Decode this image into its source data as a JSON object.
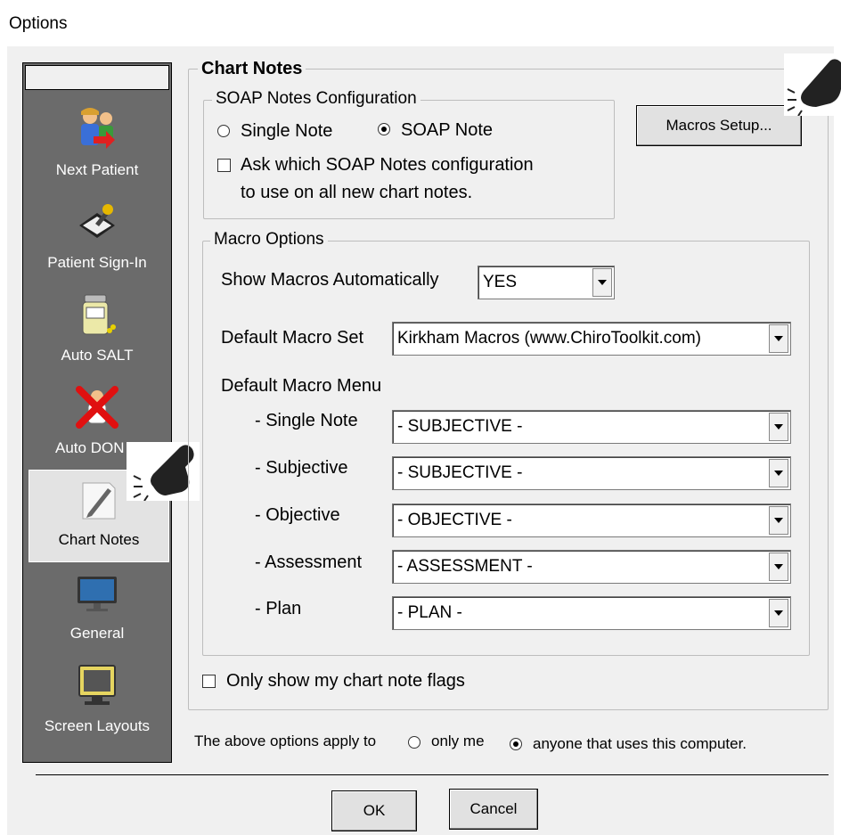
{
  "window": {
    "title": "Options"
  },
  "sidebar": {
    "items": [
      {
        "label": "Next Patient",
        "icon": "patients-icon"
      },
      {
        "label": "Patient Sign-In",
        "icon": "signin-pen-icon"
      },
      {
        "label": "Auto SALT",
        "icon": "salt-jar-icon"
      },
      {
        "label": "Auto DON",
        "icon": "red-x-person-icon"
      },
      {
        "label": "Chart Notes",
        "icon": "pencil-paper-icon"
      },
      {
        "label": "General",
        "icon": "monitor-icon"
      },
      {
        "label": "Screen Layouts",
        "icon": "screen-layout-icon"
      }
    ]
  },
  "chart_notes": {
    "legend": "Chart Notes",
    "soap": {
      "legend": "SOAP Notes Configuration",
      "single_note": "Single Note",
      "soap_note": "SOAP Note",
      "selected": "SOAP Note",
      "ask_line1": "Ask which SOAP Notes configuration",
      "ask_line2": "to use on all new chart notes."
    },
    "macros_setup_button": "Macros Setup...",
    "macro_options": {
      "legend": "Macro Options",
      "show_auto_label": "Show Macros Automatically",
      "show_auto_value": "YES",
      "default_set_label": "Default Macro Set",
      "default_set_value": "Kirkham Macros (www.ChiroToolkit.com)",
      "default_menu_label": "Default Macro Menu",
      "menus": [
        {
          "label": "- Single Note",
          "value": "- SUBJECTIVE -"
        },
        {
          "label": "- Subjective",
          "value": "- SUBJECTIVE -"
        },
        {
          "label": "- Objective",
          "value": "- OBJECTIVE -"
        },
        {
          "label": "- Assessment",
          "value": "- ASSESSMENT -"
        },
        {
          "label": "- Plan",
          "value": "- PLAN -"
        }
      ]
    },
    "only_flags": "Only show my chart note flags"
  },
  "apply": {
    "label": "The above options apply to",
    "only_me": "only me",
    "anyone": "anyone that uses this computer.",
    "selected": "anyone that uses this computer."
  },
  "buttons": {
    "ok": "OK",
    "cancel": "Cancel"
  }
}
